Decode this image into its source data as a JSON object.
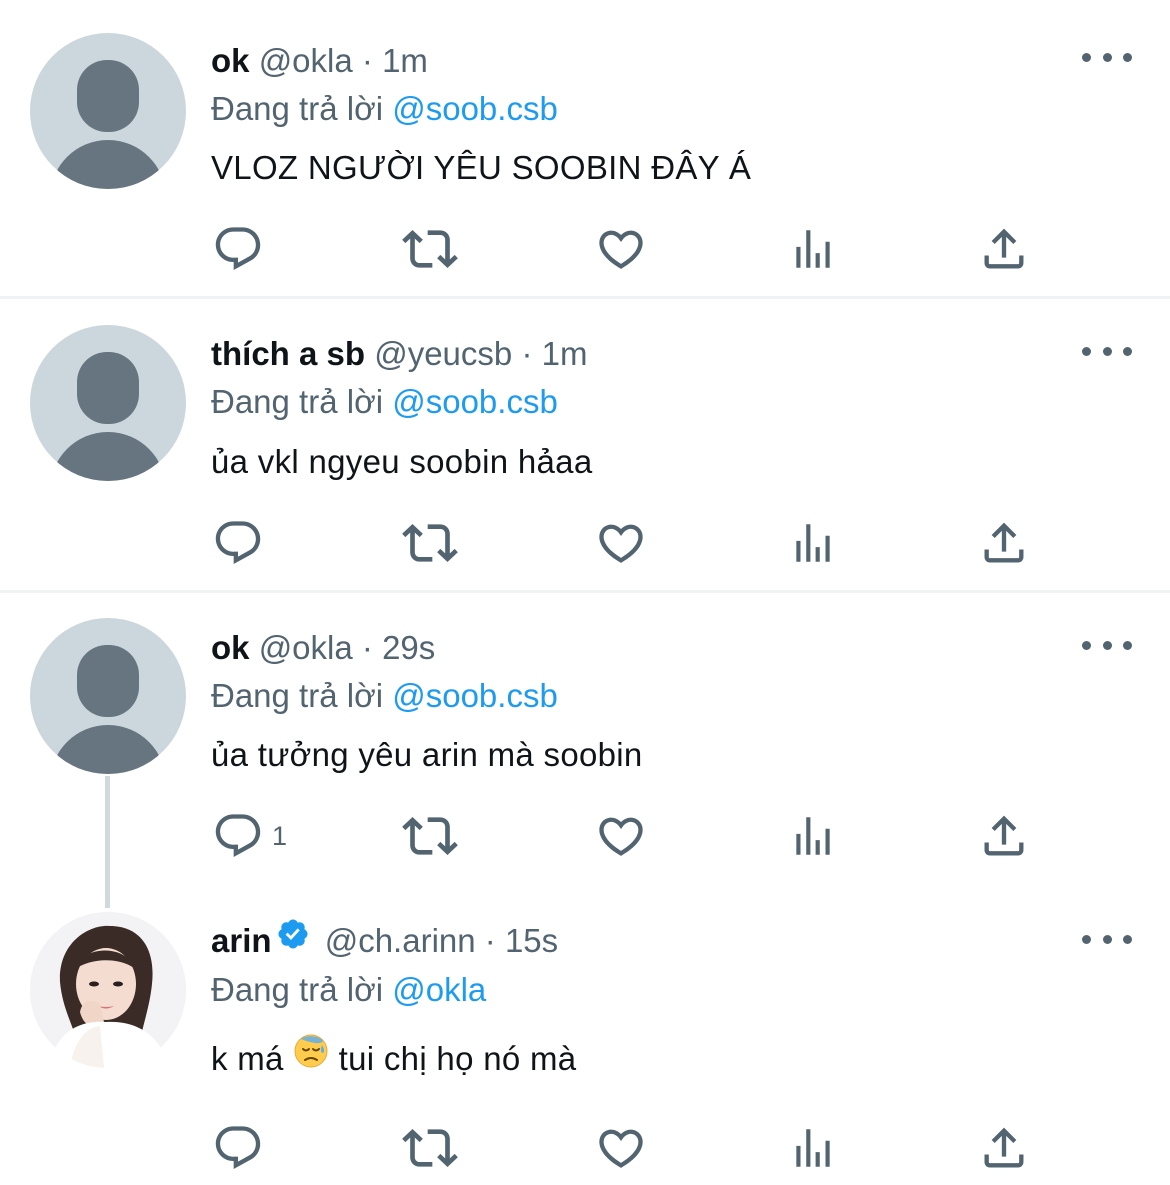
{
  "tweets": [
    {
      "name": "ok",
      "handle": "@okla",
      "time": "1m",
      "reply_prefix": "Đang trả lời",
      "reply_to": "@soob.csb",
      "text": "VLOZ NGƯỜI YÊU SOOBIN ĐÂY Á",
      "reply_count": ""
    },
    {
      "name": "thích a sb",
      "handle": "@yeucsb",
      "time": "1m",
      "reply_prefix": "Đang trả lời",
      "reply_to": "@soob.csb",
      "text": "ủa vkl ngyeu soobin hảaa",
      "reply_count": ""
    },
    {
      "name": "ok",
      "handle": "@okla",
      "time": "29s",
      "reply_prefix": "Đang trả lời",
      "reply_to": "@soob.csb",
      "text": "ủa tưởng yêu arin mà soobin",
      "reply_count": "1"
    },
    {
      "name": "arin",
      "handle": "@ch.arinn",
      "time": "15s",
      "reply_prefix": "Đang trả lời",
      "reply_to": "@okla",
      "text_before_emoji": "k má",
      "text_after_emoji": "tui chị họ nó mà",
      "emoji": "downcast-face-with-sweat",
      "verified": true,
      "reply_count": ""
    }
  ],
  "separator": "·",
  "colors": {
    "link": "#1d9bf0",
    "secondary": "#536471",
    "primary_text": "#0f1419",
    "default_avatar_bg": "#ccd6dd",
    "default_avatar_fg": "#66757f",
    "divider": "#eff3f4"
  },
  "icons": [
    "reply-icon",
    "retweet-icon",
    "like-icon",
    "analytics-icon",
    "share-icon",
    "more-icon",
    "verified-badge-icon"
  ]
}
